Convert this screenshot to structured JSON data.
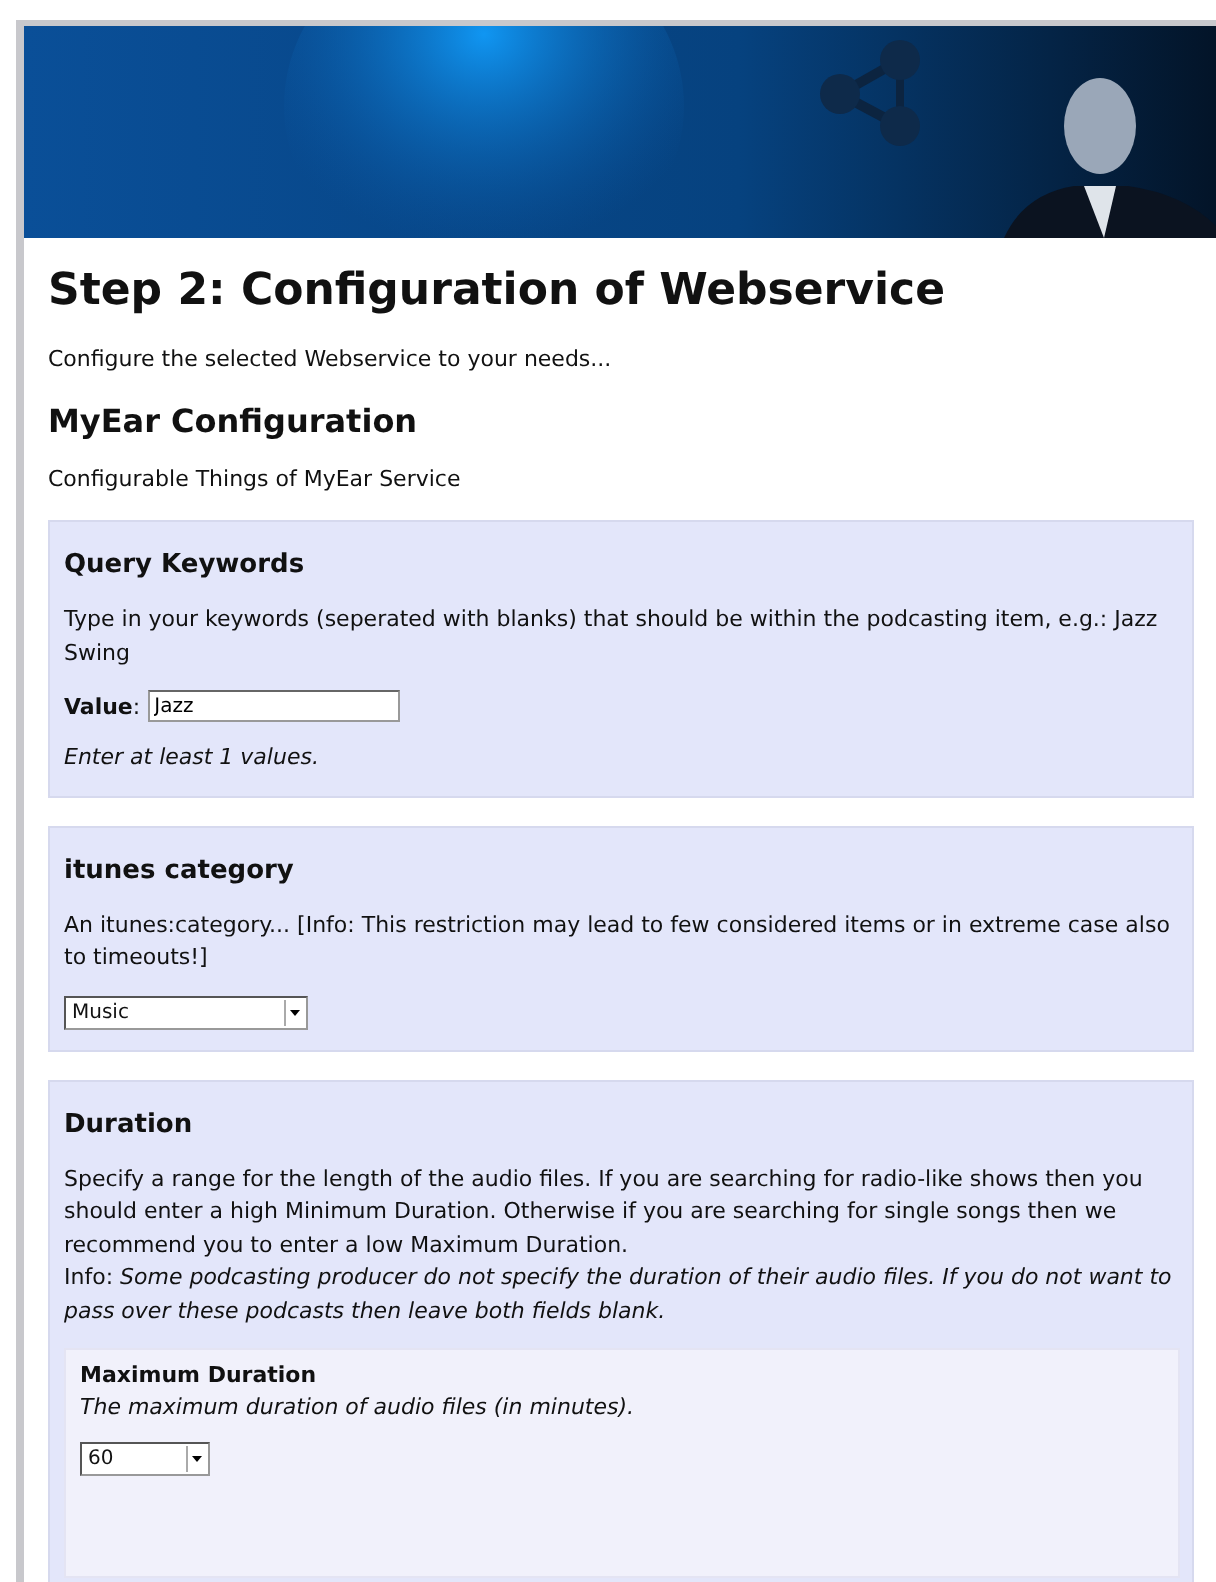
{
  "title": "Step 2: Configuration of Webservice",
  "intro": "Configure the selected Webservice to your needs...",
  "service": {
    "title": "MyEar Configuration",
    "subtitle": "Configurable Things of MyEar Service"
  },
  "sections": [
    {
      "kind": "text",
      "title": "Query Keywords",
      "description": "Type in your keywords (seperated with blanks) that should be within the podcasting item, e.g.: Jazz Swing",
      "label": "**Value**:",
      "value": "Jazz",
      "hint": "Enter at least 1 values."
    },
    {
      "kind": "select",
      "title": "itunes category",
      "description": "An itunes:category... [Info: This restriction may lead to few considered items or in extreme case also to timeouts!]",
      "value": "Music"
    },
    {
      "kind": "group",
      "title": "Duration",
      "description": "Specify a range for the length of the audio files. If you are searching for radio-like shows then you should enter a high Minimum Duration. Otherwise if you are searching for single songs then we recommend you to enter a low Maximum Duration.",
      "info": "Info: *Some podcasting producer do not specify the duration of their audio files. If you do not want to pass over these podcasts then leave both fields blank.*",
      "fields": [
        {
          "title": "Maximum Duration",
          "description": "The maximum duration of audio files (in minutes).",
          "value": "60"
        }
      ]
    }
  ]
}
